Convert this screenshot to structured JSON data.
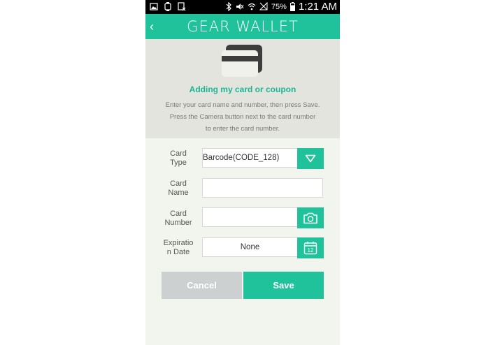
{
  "status_bar": {
    "battery": "75%",
    "time": "1:21 AM"
  },
  "header": {
    "title": "GEAR WALLET",
    "back_glyph": "‹"
  },
  "info": {
    "title": "Adding my card or coupon",
    "lines": [
      "Enter your card name and number, then press Save.",
      "Press the Camera button next to the card number",
      "to enter the card number."
    ]
  },
  "form": {
    "card_type": {
      "label_1": "Card",
      "label_2": "Type",
      "value": "Barcode(CODE_128)"
    },
    "card_name": {
      "label_1": "Card",
      "label_2": "Name",
      "value": ""
    },
    "card_number": {
      "label_1": "Card",
      "label_2": "Number",
      "value": ""
    },
    "expiration": {
      "label_1": "Expiratio",
      "label_2": "n Date",
      "value": "None",
      "calendar_day": "12"
    }
  },
  "buttons": {
    "cancel": "Cancel",
    "save": "Save"
  },
  "colors": {
    "accent": "#1fc29a",
    "accent_text": "#1fb592",
    "cancel_bg": "#cdd0d0",
    "info_bg": "#e3e4de",
    "page_bg": "#f2f4ee"
  },
  "icons": {
    "back": "chevron-left-icon",
    "card": "credit-card-icon",
    "dropdown": "triangle-down-icon",
    "camera": "camera-icon",
    "calendar": "calendar-icon"
  }
}
